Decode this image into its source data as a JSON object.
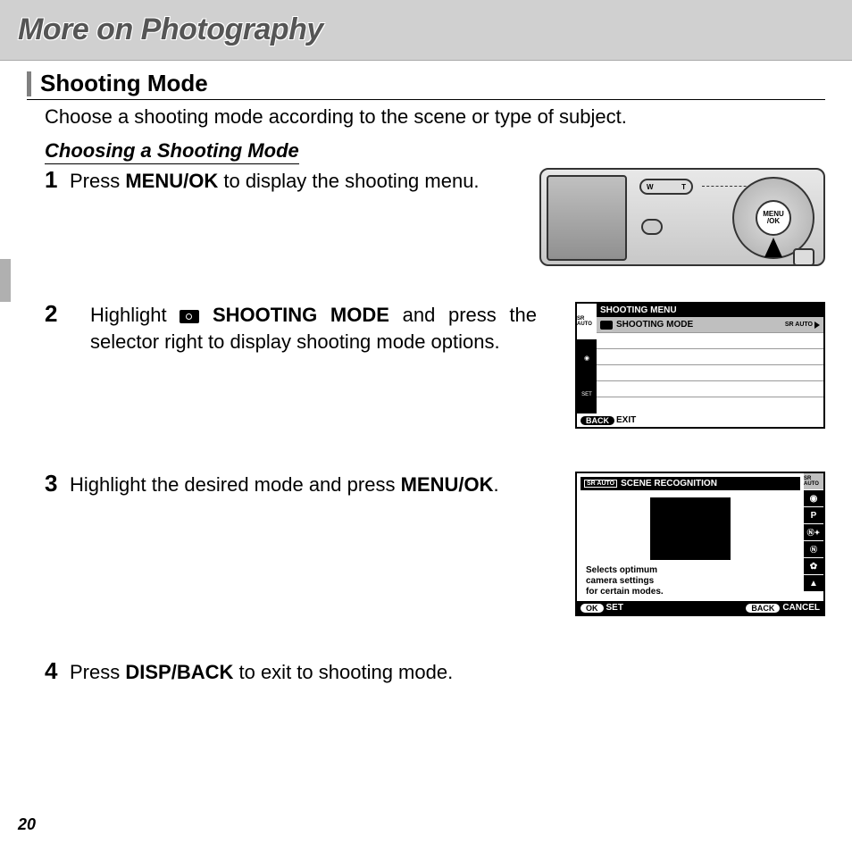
{
  "header": {
    "title": "More on Photography"
  },
  "section": {
    "title": "Shooting Mode",
    "intro": "Choose a shooting mode according to the scene or type of subject."
  },
  "subhead": "Choosing a Shooting Mode",
  "steps": {
    "s1_pre": "Press ",
    "s1_b1": "MENU/OK",
    "s1_post": " to display the shooting menu.",
    "s2_pre": "Highlight ",
    "s2_b1": "SHOOTING MODE",
    "s2_post": " and press the selector right to display shooting mode options.",
    "s3_pre": "Highlight the desired mode and press ",
    "s3_b1": "MENU/OK",
    "s3_post": ".",
    "s4_pre": "Press ",
    "s4_b1": "DISP/BACK",
    "s4_post": " to exit to shooting mode."
  },
  "nums": {
    "n1": "1",
    "n2": "2",
    "n3": "3",
    "n4": "4"
  },
  "camera": {
    "menu_label": "MENU /OK",
    "zoom_w": "W",
    "zoom_t": "T"
  },
  "lcd1": {
    "title": "SHOOTING MENU",
    "row1_label": "SHOOTING MODE",
    "row1_value": "SR AUTO",
    "tab1": "SR AUTO",
    "tab_set": "SET",
    "footer_back": "BACK",
    "footer_exit": "EXIT"
  },
  "lcd2": {
    "title": "SCENE RECOGNITION",
    "title_badge": "SR AUTO",
    "desc1": "Selects optimum",
    "desc2": "camera settings",
    "desc3": "for certain modes.",
    "side0": "SR AUTO",
    "side1": "",
    "side2": "P",
    "side3": "N",
    "side4": "",
    "side5": "",
    "footer_ok": "OK",
    "footer_set": "SET",
    "footer_back": "BACK",
    "footer_cancel": "CANCEL"
  },
  "page_number": "20"
}
